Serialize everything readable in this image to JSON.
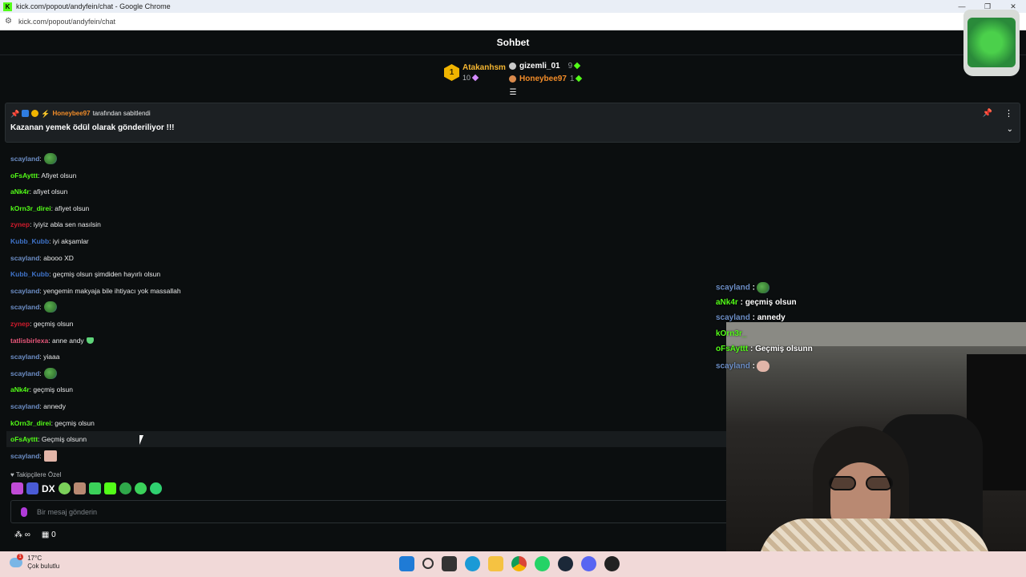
{
  "browser": {
    "window_title": "kick.com/popout/andyfein/chat - Google Chrome",
    "favicon_letter": "K",
    "url": "kick.com/popout/andyfein/chat",
    "controls": [
      "—",
      "❐",
      "✕"
    ]
  },
  "chat": {
    "header_title": "Sohbet",
    "leaderboard": {
      "first": {
        "rank": "1",
        "name": "Atakanhsm",
        "count": "10"
      },
      "others": [
        {
          "name": "gizemli_01",
          "count": "9"
        },
        {
          "name": "Honeybee97",
          "count": "1"
        }
      ]
    },
    "pinned": {
      "pinner": "Honeybee97",
      "pinned_by_suffix": "tarafından sabitlendi",
      "message": "Kazanan yemek ödül olarak gönderiliyor !!!"
    },
    "messages": [
      {
        "user": "scayland",
        "color": "#6d8fc7",
        "text": "",
        "emote": "frog"
      },
      {
        "user": "oFsAyttt",
        "color": "#53fc18",
        "text": ": Afiyet olsun",
        "emote": ""
      },
      {
        "user": "aNk4r",
        "color": "#53fc18",
        "text": ": afiyet olsun",
        "emote": ""
      },
      {
        "user": "kOrn3r_direi",
        "color": "#53fc18",
        "text": ": afiyet olsun",
        "emote": ""
      },
      {
        "user": "zynep",
        "color": "#d11b2c",
        "text": ": iyiyiz abla sen nasılsin",
        "emote": ""
      },
      {
        "user": "Kubb_Kubb",
        "color": "#3f73c9",
        "text": ": iyi akşamlar",
        "emote": ""
      },
      {
        "user": "scayland",
        "color": "#6d8fc7",
        "text": ": abooo XD",
        "emote": ""
      },
      {
        "user": "Kubb_Kubb",
        "color": "#3f73c9",
        "text": ": geçmiş olsun şimdiden hayırlı olsun",
        "emote": ""
      },
      {
        "user": "scayland",
        "color": "#6d8fc7",
        "text": ": yengemin makyaja bile ihtiyacı yok massallah",
        "emote": ""
      },
      {
        "user": "scayland",
        "color": "#6d8fc7",
        "text": "",
        "emote": "frog"
      },
      {
        "user": "zynep",
        "color": "#d11b2c",
        "text": ": geçmiş olsun",
        "emote": ""
      },
      {
        "user": "tatlisbirlexa",
        "color": "#e8577a",
        "text": ": anne andy",
        "emote": "heart"
      },
      {
        "user": "scayland",
        "color": "#6d8fc7",
        "text": ": yiaaa",
        "emote": ""
      },
      {
        "user": "scayland",
        "color": "#6d8fc7",
        "text": "",
        "emote": "frog"
      },
      {
        "user": "aNk4r",
        "color": "#53fc18",
        "text": ": geçmiş olsun",
        "emote": ""
      },
      {
        "user": "scayland",
        "color": "#6d8fc7",
        "text": ": annedy",
        "emote": ""
      },
      {
        "user": "kOrn3r_direi",
        "color": "#53fc18",
        "text": ": geçmiş olsun",
        "emote": ""
      },
      {
        "user": "oFsAyttt",
        "color": "#53fc18",
        "text": ": Geçmiş olsunn",
        "emote": ""
      },
      {
        "user": "scayland",
        "color": "#6d8fc7",
        "text": "",
        "emote": "face"
      }
    ],
    "followers_only_label": "Takipçilere Özel",
    "emote_bar_text": "DX",
    "input_placeholder": "Bir mesaj gönderin",
    "bottom_infinity": "∞",
    "bottom_count": "0"
  },
  "stream_overlay": [
    {
      "user": "scayland",
      "color": "#6d8fc7",
      "text": " :",
      "emote": "frog"
    },
    {
      "user": "aNk4r",
      "color": "#53fc18",
      "text": " : geçmiş olsun",
      "emote": ""
    },
    {
      "user": "scayland",
      "color": "#6d8fc7",
      "text": " : annedy",
      "emote": ""
    },
    {
      "user": "kOrn3r_",
      "color": "#53fc18",
      "text": "",
      "emote": ""
    },
    {
      "user": "oFsAyttt",
      "color": "#53fc18",
      "text": " : Geçmiş olsunn",
      "emote": ""
    },
    {
      "user": "scayland",
      "color": "#6d8fc7",
      "text": " :",
      "emote": "face"
    }
  ],
  "taskbar": {
    "weather_temp": "17°C",
    "weather_desc": "Çok bulutlu",
    "weather_badge": "1"
  }
}
